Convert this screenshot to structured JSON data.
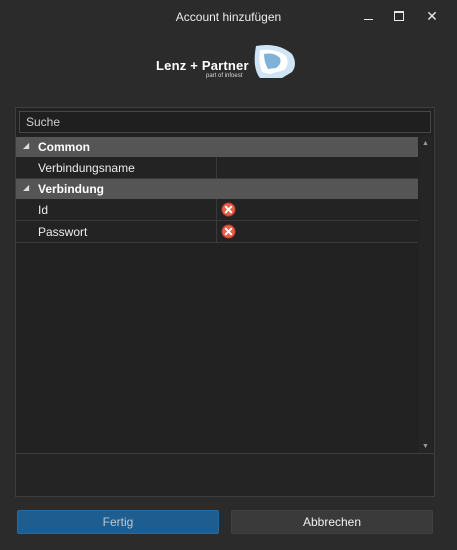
{
  "window": {
    "title": "Account hinzufügen",
    "controls": {
      "minimize": "minimize-icon",
      "maximize": "maximize-icon",
      "close": "close-icon",
      "close_glyph": "✕"
    }
  },
  "logo": {
    "text": "Lenz + Partner",
    "subtitle": "part of infoest"
  },
  "search": {
    "placeholder": "Suche",
    "value": ""
  },
  "property_grid": {
    "categories": [
      {
        "label": "Common",
        "expanded": true,
        "rows": [
          {
            "name": "Verbindungsname",
            "value": "",
            "error": false
          }
        ]
      },
      {
        "label": "Verbindung",
        "expanded": true,
        "rows": [
          {
            "name": "Id",
            "value": "",
            "error": true
          },
          {
            "name": "Passwort",
            "value": "",
            "error": true
          }
        ]
      }
    ],
    "expand_glyph": "◢",
    "scroll_up_glyph": "▲",
    "scroll_down_glyph": "▼"
  },
  "buttons": {
    "ok": "Fertig",
    "cancel": "Abbrechen"
  },
  "colors": {
    "background": "#2b2b2c",
    "category": "#555555",
    "primary": "#1d5d8f",
    "error": "#e8604c"
  }
}
